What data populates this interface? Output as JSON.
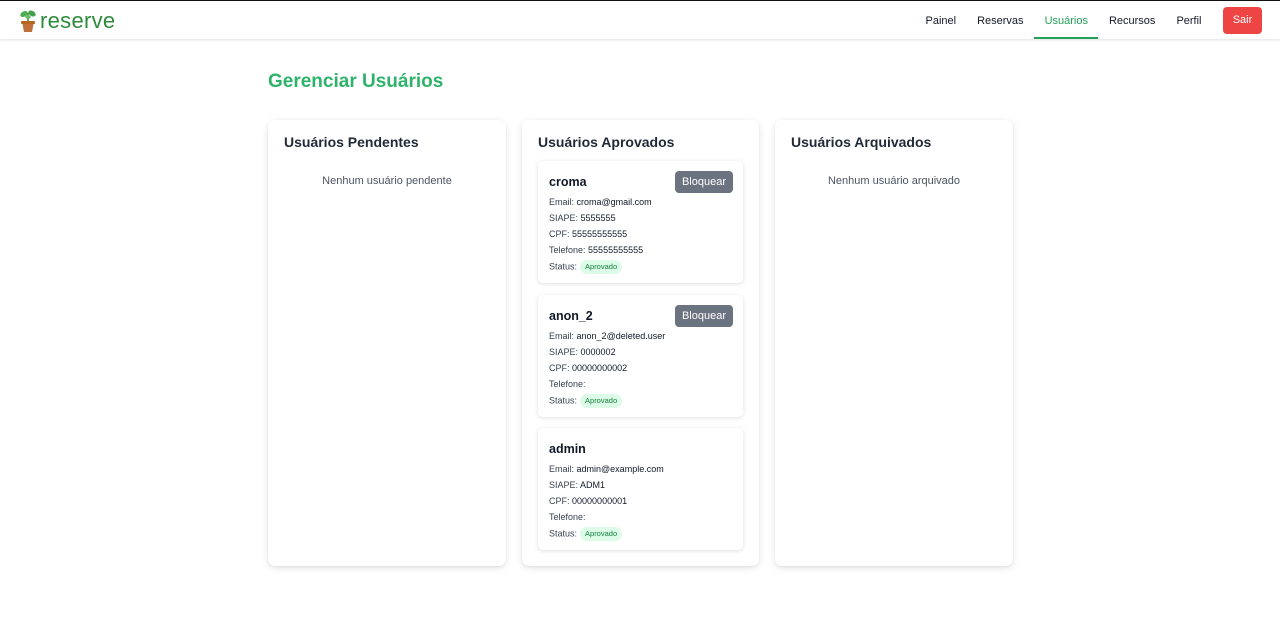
{
  "brand": {
    "name": "reserve"
  },
  "nav": {
    "links": [
      "Painel",
      "Reservas",
      "Usuários",
      "Recursos",
      "Perfil"
    ],
    "active": "Usuários",
    "logout_label": "Sair"
  },
  "page": {
    "title": "Gerenciar Usuários"
  },
  "columns": {
    "pending": {
      "title": "Usuários Pendentes",
      "empty": "Nenhum usuário pendente"
    },
    "approved": {
      "title": "Usuários Aprovados"
    },
    "archived": {
      "title": "Usuários Arquivados",
      "empty": "Nenhum usuário arquivado"
    }
  },
  "labels": {
    "email": "Email:",
    "siape": "SIAPE:",
    "cpf": "CPF:",
    "phone": "Telefone:",
    "status": "Status:",
    "block": "Bloquear"
  },
  "users": [
    {
      "name": "croma",
      "email": "croma@gmail.com",
      "siape": "5555555",
      "cpf": "55555555555",
      "phone": "55555555555",
      "status": "Aprovado",
      "show_block": true
    },
    {
      "name": "anon_2",
      "email": "anon_2@deleted.user",
      "siape": "0000002",
      "cpf": "00000000002",
      "phone": "",
      "status": "Aprovado",
      "show_block": true
    },
    {
      "name": "admin",
      "email": "admin@example.com",
      "siape": "ADM1",
      "cpf": "00000000001",
      "phone": "",
      "status": "Aprovado",
      "show_block": false
    }
  ],
  "colors": {
    "brand_green": "#2fb36b",
    "logout_red": "#ef4444",
    "block_gray": "#6b7280",
    "badge_bg": "#dcfce7",
    "badge_text": "#15803d"
  }
}
